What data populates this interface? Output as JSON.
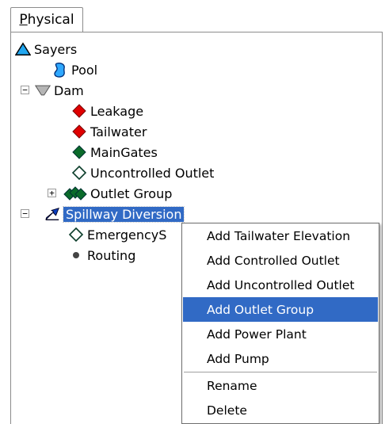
{
  "tab": {
    "label": "Physical"
  },
  "tree": {
    "root": "Sayers",
    "pool": "Pool",
    "dam": "Dam",
    "leakage": "Leakage",
    "tailwater": "Tailwater",
    "main_gates": "MainGates",
    "uncontrolled_outlet": "Uncontrolled Outlet",
    "outlet_group": "Outlet Group",
    "spillway_diversion": "Spillway Diversion",
    "emergency": "EmergencyS",
    "routing": "Routing",
    "expander_collapse": "−",
    "expander_expand": "+"
  },
  "context_menu": {
    "items": [
      "Add Tailwater Elevation",
      "Add Controlled Outlet",
      "Add Uncontrolled Outlet",
      "Add Outlet Group",
      "Add Power Plant",
      "Add Pump",
      "Rename",
      "Delete"
    ],
    "highlighted": "Add Outlet Group"
  },
  "colors": {
    "selection": "#316ac5",
    "red_diamond": "#e00000",
    "green_diamond": "#0b6b2a",
    "triangle_fill": "#22a7f0",
    "pool_fill": "#2fa8ff"
  }
}
